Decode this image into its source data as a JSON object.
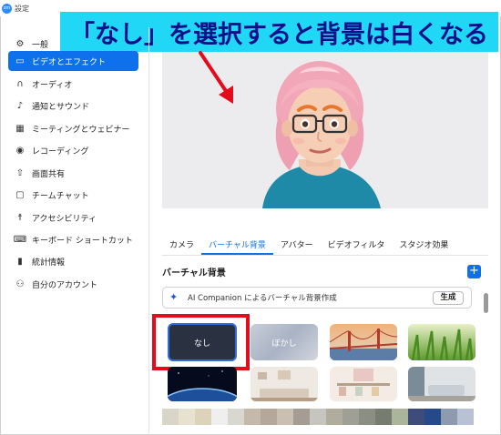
{
  "window": {
    "app_icon_text": "zm",
    "title": "設定"
  },
  "annotation": {
    "banner_text": "「なし」を選択すると背景は白くなる",
    "banner_color": "#21d7f6",
    "banner_text_color": "#0a0f8a",
    "highlight_color": "#e40b1b"
  },
  "sidebar": {
    "items": [
      {
        "label": "一般",
        "icon": "gear-icon",
        "glyph": "⚙",
        "active": false
      },
      {
        "label": "ビデオとエフェクト",
        "icon": "video-camera-icon",
        "glyph": "▭",
        "active": true
      },
      {
        "label": "オーディオ",
        "icon": "headphones-icon",
        "glyph": "∩",
        "active": false
      },
      {
        "label": "通知とサウンド",
        "icon": "bell-icon",
        "glyph": "♪",
        "active": false
      },
      {
        "label": "ミーティングとウェビナー",
        "icon": "calendar-icon",
        "glyph": "▦",
        "active": false
      },
      {
        "label": "レコーディング",
        "icon": "record-icon",
        "glyph": "◉",
        "active": false
      },
      {
        "label": "画面共有",
        "icon": "share-screen-icon",
        "glyph": "⇧",
        "active": false
      },
      {
        "label": "チームチャット",
        "icon": "chat-icon",
        "glyph": "▢",
        "active": false
      },
      {
        "label": "アクセシビリティ",
        "icon": "accessibility-icon",
        "glyph": "☨",
        "active": false
      },
      {
        "label": "キーボード ショートカット",
        "icon": "keyboard-icon",
        "glyph": "⌨",
        "active": false
      },
      {
        "label": "統計情報",
        "icon": "bar-chart-icon",
        "glyph": "▮",
        "active": false
      },
      {
        "label": "自分のアカウント",
        "icon": "user-icon",
        "glyph": "⚇",
        "active": false
      }
    ],
    "accent_color": "#0e71eb"
  },
  "tabs": [
    {
      "label": "カメラ",
      "active": false
    },
    {
      "label": "バーチャル背景",
      "active": true
    },
    {
      "label": "アバター",
      "active": false
    },
    {
      "label": "ビデオフィルタ",
      "active": false
    },
    {
      "label": "スタジオ効果",
      "active": false
    }
  ],
  "virtual_background": {
    "section_title": "バーチャル背景",
    "add_label": "+",
    "ai_prompt": "AI Companion によるバーチャル背景作成",
    "ai_button": "生成",
    "thumbnails": [
      {
        "label": "なし",
        "kind": "none",
        "selected": true
      },
      {
        "label": "ぼかし",
        "kind": "blur",
        "selected": false
      },
      {
        "label": "",
        "kind": "golden-gate-bridge",
        "selected": false
      },
      {
        "label": "",
        "kind": "grass",
        "selected": false
      },
      {
        "label": "",
        "kind": "earth-from-space",
        "selected": false
      },
      {
        "label": "",
        "kind": "living-room",
        "selected": false
      },
      {
        "label": "",
        "kind": "cafe-shelves",
        "selected": false
      },
      {
        "label": "",
        "kind": "lounge",
        "selected": false
      }
    ],
    "swatches": [
      "#d9d5c8",
      "#e7e1cf",
      "#ddd2ba",
      "#efefef",
      "#dad6d0",
      "#c5b9ac",
      "#b5a89b",
      "#c9c0b2",
      "#a59d94",
      "#c7c5c0",
      "#b2ac9e",
      "#9f9f95",
      "#8b8f83",
      "#767c70",
      "#aab59b",
      "#3d4c7a",
      "#274889",
      "#8d9ab0",
      "#b8c2d4"
    ]
  }
}
